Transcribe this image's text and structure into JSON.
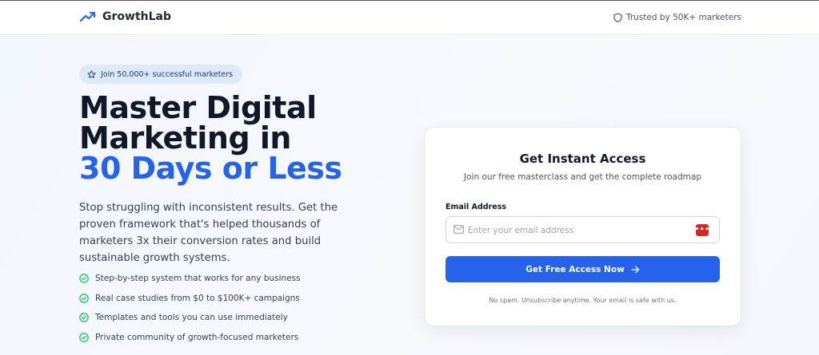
{
  "header": {
    "brand_name": "GrowthLab",
    "brand_icon": "trending-up-icon",
    "trust_text": "Trusted by 50K+ marketers",
    "trust_icon": "shield-icon"
  },
  "hero": {
    "badge_text": "Join 50,000+ successful marketers",
    "badge_icon": "star-icon",
    "headline_line1": "Master Digital",
    "headline_line2": "Marketing in",
    "headline_accent": "30 Days or Less",
    "description": "Stop struggling with inconsistent results. Get the proven framework that's helped thousands of marketers 3x their conversion rates and build sustainable growth systems.",
    "features": [
      "Step-by-step system that works for any business",
      "Real case studies from $0 to $100K+ campaigns",
      "Templates and tools you can use immediately",
      "Private community of growth-focused marketers"
    ],
    "feature_icon": "check-circle-icon"
  },
  "signup": {
    "title": "Get Instant Access",
    "subtitle": "Join our free masterclass and get the complete roadmap",
    "email_label": "Email Address",
    "email_value": "",
    "email_placeholder": "Enter your email address",
    "cta_label": "Get Free Access Now",
    "cta_icon": "arrow-right-icon",
    "fine_print": "No spam. Unsubscribe anytime. Your email is safe with us."
  },
  "colors": {
    "accent": "#2563eb",
    "heading": "#111827",
    "success": "#22c55e",
    "badge_bg": "#dde8fb",
    "password_manager": "#dc2626"
  }
}
